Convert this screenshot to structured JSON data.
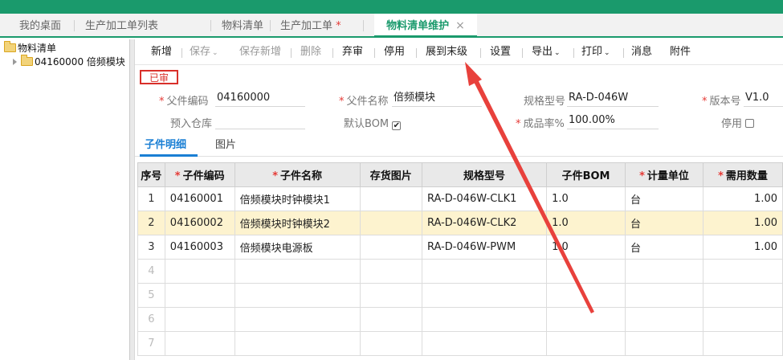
{
  "tabbar": {
    "tabs": [
      {
        "label": "我的桌面"
      },
      {
        "label": "生产加工单列表"
      },
      {
        "label": "物料清单"
      },
      {
        "label": "生产加工单",
        "modified": "*"
      },
      {
        "label": "物料清单维护",
        "close": "×"
      }
    ]
  },
  "tree": {
    "root": "物料清单",
    "child": "04160000 倍频模块"
  },
  "toolbar": {
    "new": "新增",
    "save": "保存",
    "save_new": "保存新增",
    "delete": "删除",
    "abandon": "弃审",
    "disable": "停用",
    "expand_last": "展到末级",
    "settings": "设置",
    "export": "导出",
    "print": "打印",
    "message": "消息",
    "attachment": "附件",
    "dropdown_glyph": "⌄"
  },
  "status": "已审",
  "form": {
    "required_mark": "*",
    "parent_code_label": "父件编码",
    "parent_code": "04160000",
    "parent_name_label": "父件名称",
    "parent_name": "倍频模块",
    "spec_label": "规格型号",
    "spec": "RA-D-046W",
    "version_label": "版本号",
    "version": "V1.0",
    "warehouse_label": "预入仓库",
    "warehouse": "",
    "default_bom_label": "默认BOM",
    "default_bom_check": "✔",
    "yield_label": "成品率%",
    "yield": "100.00%",
    "disabled_label": "停用"
  },
  "subtabs": {
    "detail": "子件明细",
    "picture": "图片"
  },
  "grid": {
    "headers": [
      {
        "label": "序号",
        "required": false
      },
      {
        "label": "子件编码",
        "required": true
      },
      {
        "label": "子件名称",
        "required": true
      },
      {
        "label": "存货图片",
        "required": false
      },
      {
        "label": "规格型号",
        "required": false
      },
      {
        "label": "子件BOM",
        "required": false
      },
      {
        "label": "计量单位",
        "required": true
      },
      {
        "label": "需用数量",
        "required": true
      }
    ],
    "rows": [
      {
        "no": "1",
        "code": "04160001",
        "name": "倍频模块时钟模块1",
        "image": "",
        "spec": "RA-D-046W-CLK1",
        "bom": "1.0",
        "unit": "台",
        "qty": "1.00"
      },
      {
        "no": "2",
        "code": "04160002",
        "name": "倍频模块时钟模块2",
        "image": "",
        "spec": "RA-D-046W-CLK2",
        "bom": "1.0",
        "unit": "台",
        "qty": "1.00"
      },
      {
        "no": "3",
        "code": "04160003",
        "name": "倍频模块电源板",
        "image": "",
        "spec": "RA-D-046W-PWM",
        "bom": "1.0",
        "unit": "台",
        "qty": "1.00"
      }
    ],
    "empty_rows": [
      "4",
      "5",
      "6",
      "7"
    ],
    "selected_row": "2"
  },
  "colors": {
    "brand": "#1a9a6c",
    "status_red": "#d9302a",
    "selected_row": "#fdf3cf",
    "annotation_arrow": "#e8413c"
  }
}
